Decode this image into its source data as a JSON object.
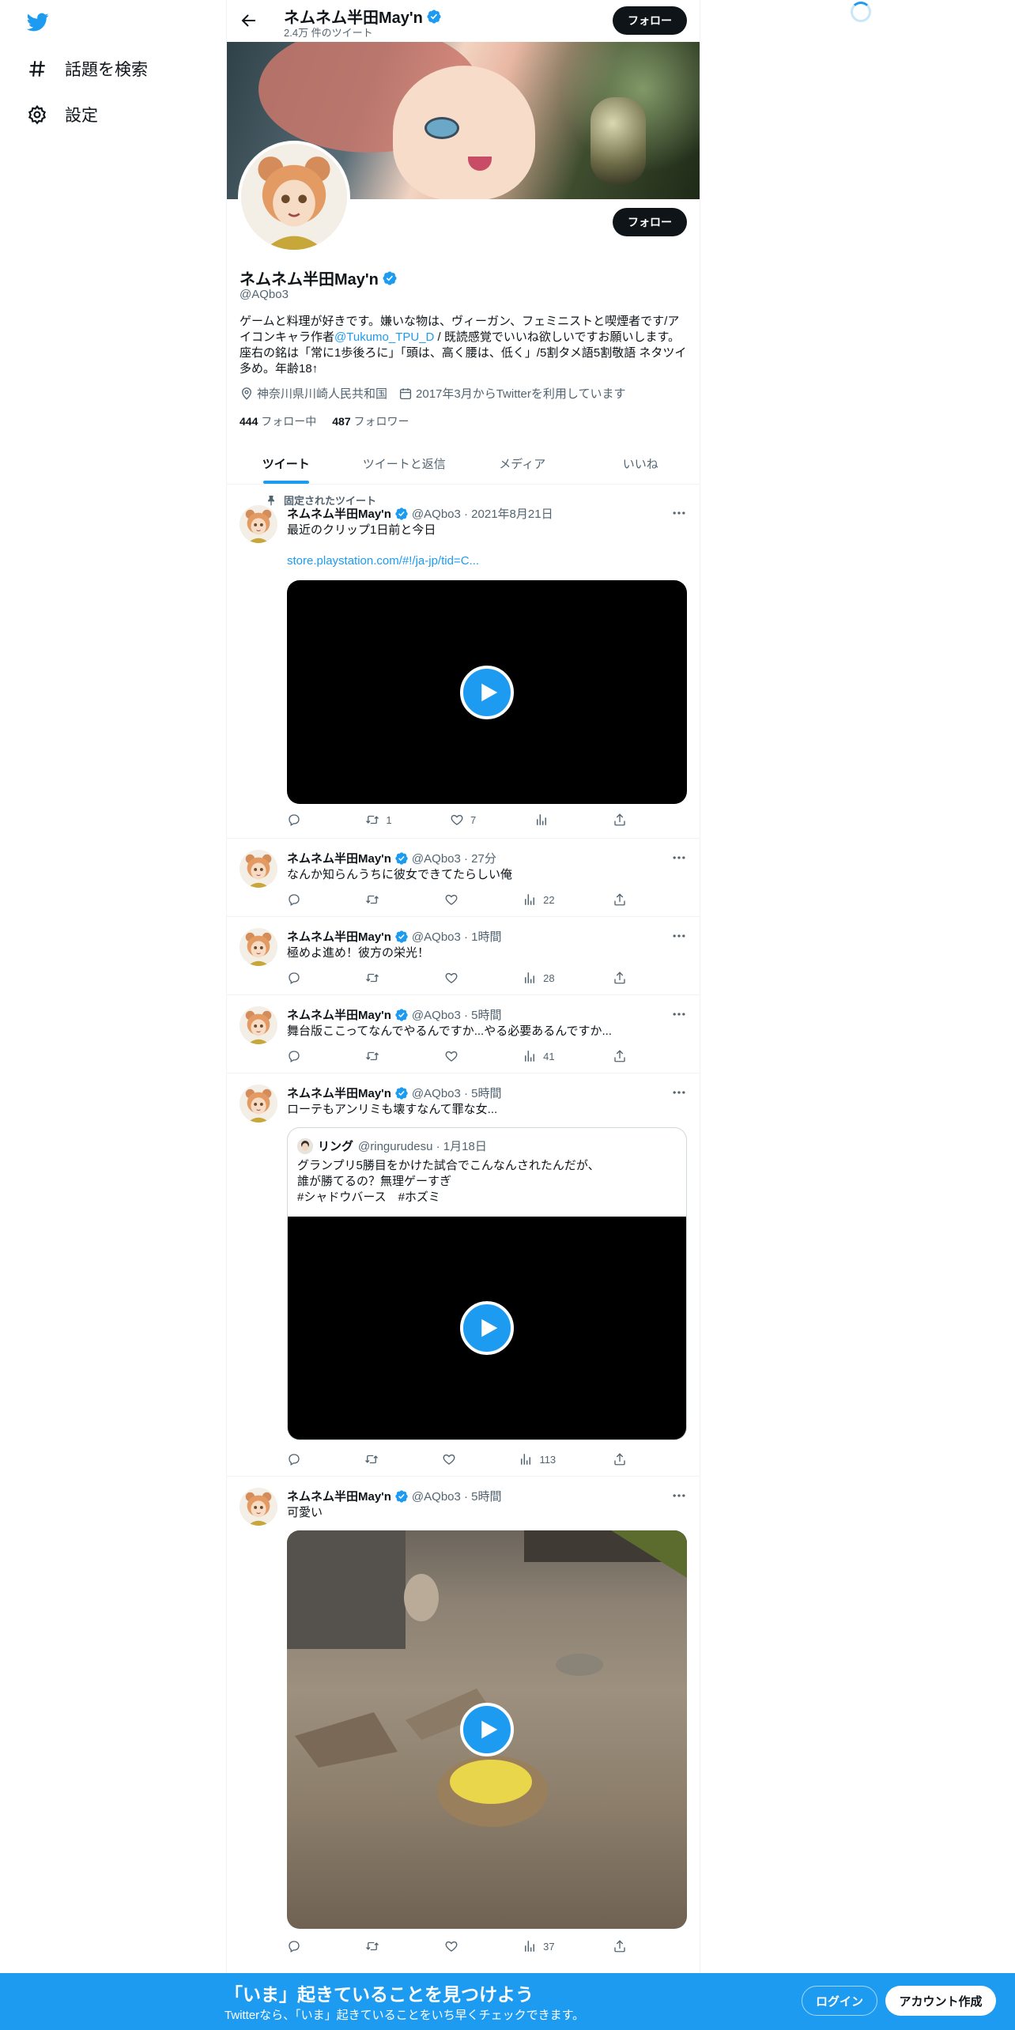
{
  "nav": {
    "logo_icon": "twitter-bird-icon",
    "items": [
      {
        "label": "話題を検索",
        "icon": "hashtag-icon"
      },
      {
        "label": "設定",
        "icon": "gear-icon"
      }
    ]
  },
  "header": {
    "name": "ネムネム半田May'n",
    "tweet_count": "2.4万 件のツイート",
    "follow_label": "フォロー"
  },
  "profile": {
    "name": "ネムネム半田May'n",
    "handle": "@AQbo3",
    "follow_label": "フォロー",
    "bio_part1": "ゲームと料理が好きです。嫌いな物は、ヴィーガン、フェミニストと喫煙者です/アイコンキャラ作者",
    "bio_link": "@Tukumo_TPU_D",
    "bio_part2": " / 既読感覚でいいね欲しいですお願いします。座右の銘は「常に1歩後ろに」「頭は、高く腰は、低く」/5割タメ語5割敬語 ネタツイ多め。年齢18↑",
    "location": "神奈川県川崎人民共和国",
    "joined": "2017年3月からTwitterを利用しています",
    "following_count": "444",
    "following_label": "フォロー中",
    "followers_count": "487",
    "followers_label": "フォロワー"
  },
  "tabs": [
    "ツイート",
    "ツイートと返信",
    "メディア",
    "いいね"
  ],
  "tweets": [
    {
      "pinned_label": "固定されたツイート",
      "name": "ネムネム半田May'n",
      "meta": "@AQbo3 · 2021年8月21日",
      "text": "最近のクリップ1日前と今日",
      "link": "store.playstation.com/#!/ja-jp/tid=C...",
      "reply": "",
      "retweet": "1",
      "like": "7",
      "views": ""
    },
    {
      "name": "ネムネム半田May'n",
      "meta": "@AQbo3 · 27分",
      "text": "なんか知らんうちに彼女できてたらしい俺",
      "reply": "",
      "retweet": "",
      "like": "",
      "views": "22"
    },
    {
      "name": "ネムネム半田May'n",
      "meta": "@AQbo3 · 1時間",
      "text": "極めよ進め！彼方の栄光！",
      "reply": "",
      "retweet": "",
      "like": "",
      "views": "28"
    },
    {
      "name": "ネムネム半田May'n",
      "meta": "@AQbo3 · 5時間",
      "text": "舞台版ここってなんでやるんですか...やる必要あるんですか...",
      "reply": "",
      "retweet": "",
      "like": "",
      "views": "41"
    },
    {
      "name": "ネムネム半田May'n",
      "meta": "@AQbo3 · 5時間",
      "text": "ローテもアンリミも壊すなんて罪な女...",
      "quote": {
        "name": "リング",
        "meta": "@ringurudesu · 1月18日",
        "line1": "グランプリ5勝目をかけた試合でこんなんされたんだが、",
        "line2": "誰が勝てるの？無理ゲーすぎ",
        "line3": "#シャドウバース　#ホズミ"
      },
      "reply": "",
      "retweet": "",
      "like": "",
      "views": "113"
    },
    {
      "name": "ネムネム半田May'n",
      "meta": "@AQbo3 · 5時間",
      "text": "可愛い",
      "reply": "",
      "retweet": "",
      "like": "",
      "views": "37"
    }
  ],
  "bottom_bar": {
    "title": "「いま」起きていることを見つけよう",
    "subtitle": "Twitterなら、「いま」起きていることをいち早くチェックできます。",
    "login": "ログイン",
    "signup": "アカウント作成"
  },
  "colors": {
    "accent": "#1d9bf0",
    "text": "#0f1419",
    "muted": "#536471"
  }
}
